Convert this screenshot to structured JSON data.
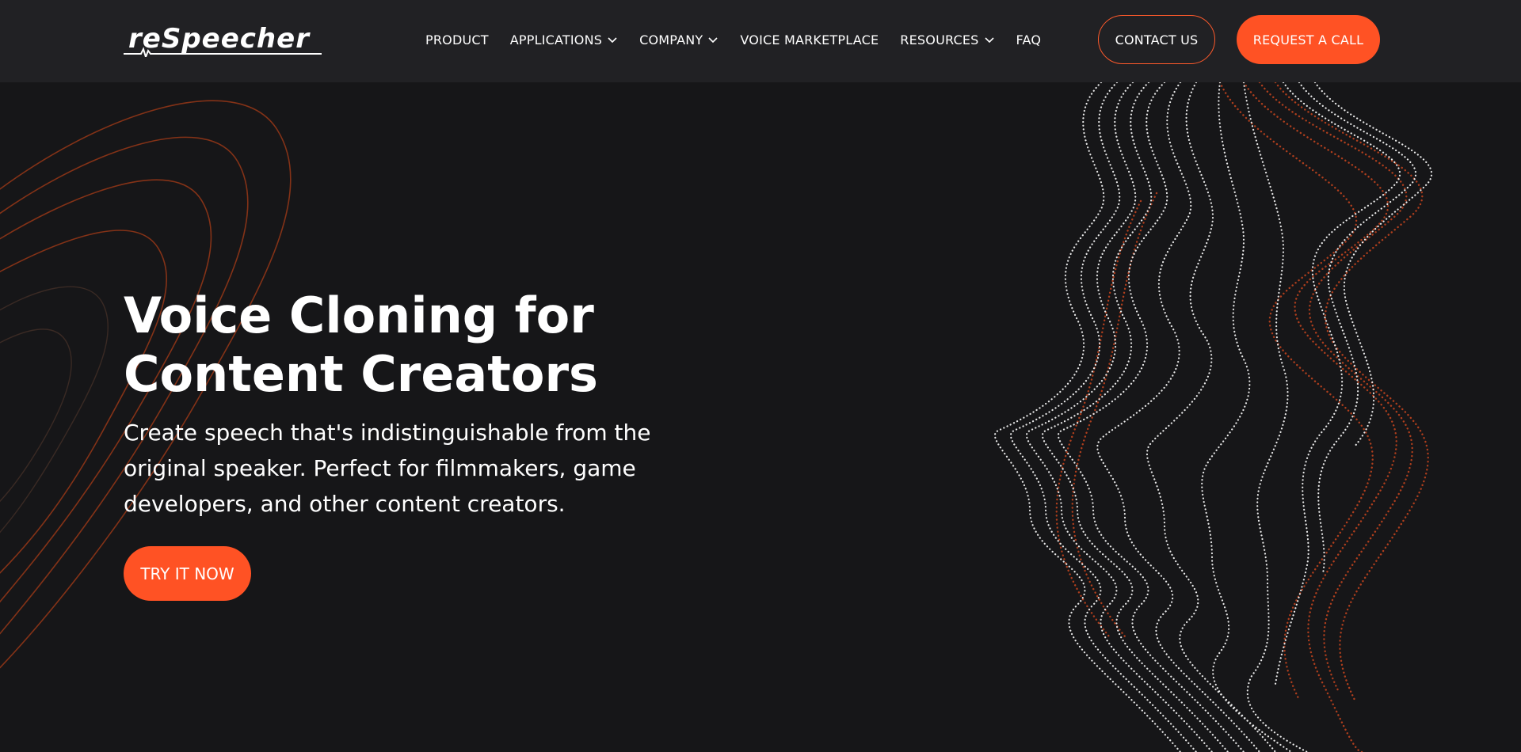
{
  "brand": {
    "logo_text": "reSpeecher",
    "accent_color": "#ff5224",
    "header_bg": "#212124",
    "page_bg": "#161618"
  },
  "nav": {
    "items": [
      {
        "label": "PRODUCT",
        "has_dropdown": false
      },
      {
        "label": "APPLICATIONS",
        "has_dropdown": true
      },
      {
        "label": "COMPANY",
        "has_dropdown": true
      },
      {
        "label": "VOICE MARKETPLACE",
        "has_dropdown": false
      },
      {
        "label": "RESOURCES",
        "has_dropdown": true
      },
      {
        "label": "FAQ",
        "has_dropdown": false
      }
    ],
    "dropdown_icon": "chevron-down-icon"
  },
  "header": {
    "contact_label": "CONTACT US",
    "request_label": "REQUEST A CALL"
  },
  "hero": {
    "title": "Voice Cloning for Content Creators",
    "subtitle": "Create speech that's indistinguishable from the original speaker. Perfect for filmmakers, game developers, and other content creators.",
    "cta_label": "TRY IT NOW"
  },
  "decorations": {
    "left": "contour-lines",
    "right": "dotted-sound-wave"
  }
}
